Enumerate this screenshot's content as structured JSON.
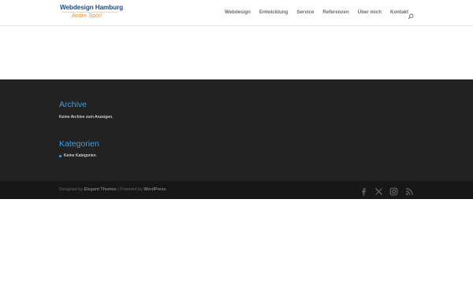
{
  "header": {
    "logo_title": "Webdesign Hamburg",
    "logo_subtitle": "Andre Spörl",
    "nav": [
      {
        "label": "Webdesign"
      },
      {
        "label": "Entwicklung"
      },
      {
        "label": "Service"
      },
      {
        "label": "Referenzen"
      },
      {
        "label": "Über mich"
      },
      {
        "label": "Kontakt"
      }
    ],
    "search_icon": "search-icon"
  },
  "footer": {
    "archive_title": "Archive",
    "archive_text": "Keine Archive zum Anzeigen.",
    "categories_title": "Kategorien",
    "categories_text": "Keine Kategorien"
  },
  "bottom_bar": {
    "designed_by": "Designed by",
    "elegant_themes": "Elegant Themes",
    "separator": "|",
    "powered_by": "Powered by",
    "wordpress": "WordPress",
    "social_icons": [
      "facebook-icon",
      "x-icon",
      "instagram-icon",
      "rss-icon"
    ]
  },
  "colors": {
    "accent": "#2ea3f2",
    "logo_blue": "#1c4d86",
    "logo_orange": "#e9892f",
    "footer_bg": "#222222",
    "bottom_bg": "#171717"
  }
}
